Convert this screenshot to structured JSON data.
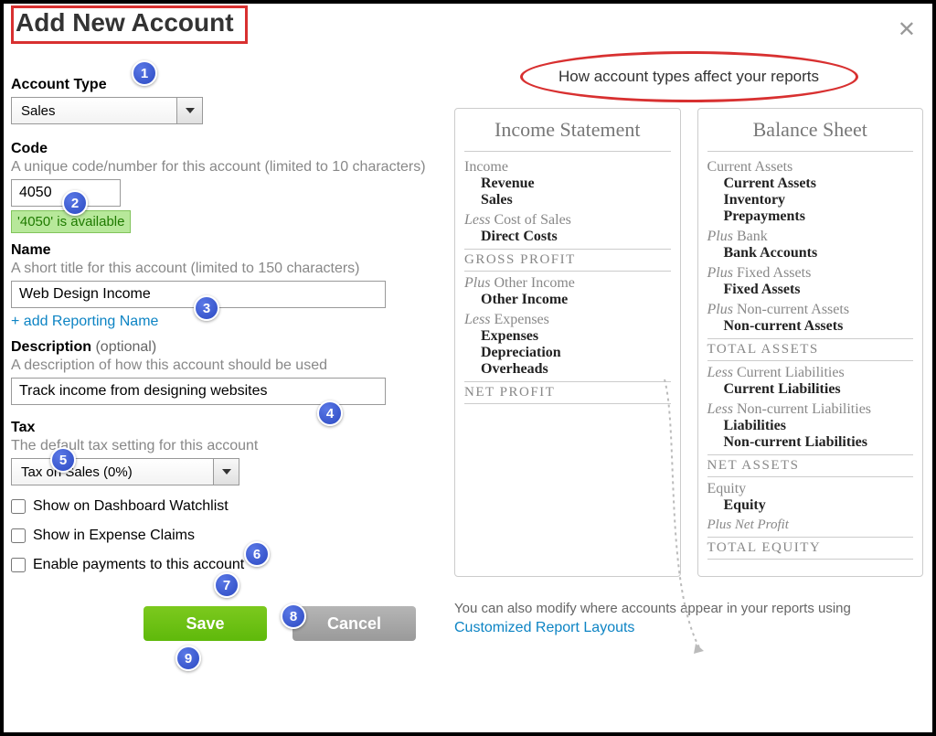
{
  "title": "Add New Account",
  "close": "✕",
  "form": {
    "account_type": {
      "label": "Account Type",
      "value": "Sales"
    },
    "code": {
      "label": "Code",
      "help": "A unique code/number for this account (limited to 10 characters)",
      "value": "4050",
      "availability": "'4050' is available"
    },
    "name": {
      "label": "Name",
      "help": "A short title for this account (limited to 150 characters)",
      "value": "Web Design Income",
      "add_reporting": "+ add Reporting Name"
    },
    "description": {
      "label": "Description",
      "optional": "(optional)",
      "help": "A description of how this account should be used",
      "value": "Track income from designing websites"
    },
    "tax": {
      "label": "Tax",
      "help": "The default tax setting for this account",
      "value": "Tax on Sales (0%)"
    },
    "checkboxes": {
      "dashboard": "Show on Dashboard Watchlist",
      "expense": "Show in Expense Claims",
      "payments": "Enable payments to this account"
    },
    "buttons": {
      "save": "Save",
      "cancel": "Cancel"
    }
  },
  "info": {
    "heading": "How account types affect your reports",
    "income_statement": {
      "title": "Income Statement",
      "income_label": "Income",
      "income_items": [
        "Revenue",
        "Sales"
      ],
      "cost_label_prefix": "Less",
      "cost_label": "Cost of Sales",
      "cost_items": [
        "Direct Costs"
      ],
      "gross_profit": "GROSS PROFIT",
      "other_income_prefix": "Plus",
      "other_income_label": "Other Income",
      "other_income_items": [
        "Other Income"
      ],
      "expenses_prefix": "Less",
      "expenses_label": "Expenses",
      "expenses_items": [
        "Expenses",
        "Depreciation",
        "Overheads"
      ],
      "net_profit": "NET PROFIT"
    },
    "balance_sheet": {
      "title": "Balance Sheet",
      "current_assets_label": "Current Assets",
      "current_assets_items": [
        "Current Assets",
        "Inventory",
        "Prepayments"
      ],
      "bank_prefix": "Plus",
      "bank_label": "Bank",
      "bank_items": [
        "Bank Accounts"
      ],
      "fixed_prefix": "Plus",
      "fixed_label": "Fixed Assets",
      "fixed_items": [
        "Fixed Assets"
      ],
      "nca_prefix": "Plus",
      "nca_label": "Non-current Assets",
      "nca_items": [
        "Non-current Assets"
      ],
      "total_assets": "TOTAL ASSETS",
      "cl_prefix": "Less",
      "cl_label": "Current Liabilities",
      "cl_items": [
        "Current Liabilities"
      ],
      "ncl_prefix": "Less",
      "ncl_label": "Non-current Liabilities",
      "ncl_items": [
        "Liabilities",
        "Non-current Liabilities"
      ],
      "net_assets": "NET ASSETS",
      "equity_label": "Equity",
      "equity_items": [
        "Equity"
      ],
      "np_prefix": "Plus",
      "np_label": "Net Profit",
      "total_equity": "TOTAL EQUITY"
    },
    "footer": {
      "text": "You can also modify where accounts appear in your reports using ",
      "link": "Customized Report Layouts"
    }
  },
  "badges": [
    "1",
    "2",
    "3",
    "4",
    "5",
    "6",
    "7",
    "8",
    "9"
  ]
}
